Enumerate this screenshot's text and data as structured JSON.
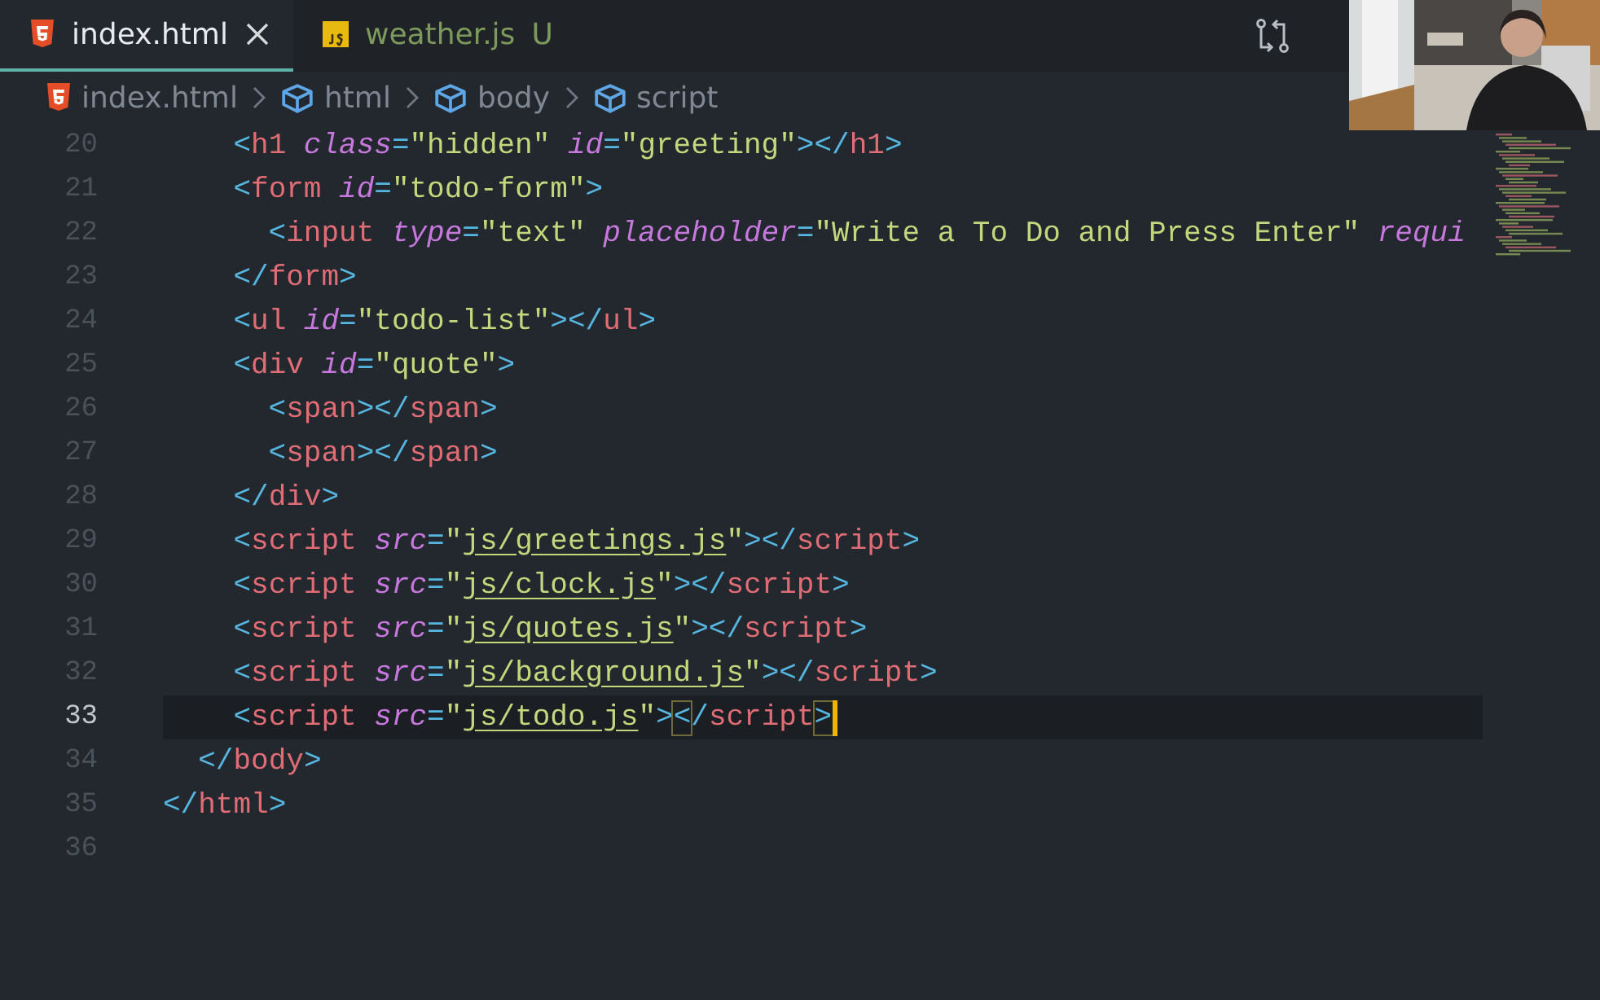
{
  "tabs": [
    {
      "label": "index.html",
      "kind": "html",
      "selected": true,
      "modified": false
    },
    {
      "label": "weather.js",
      "kind": "js",
      "selected": false,
      "modified": true,
      "badge": "U"
    }
  ],
  "breadcrumb": [
    {
      "label": "index.html",
      "kind": "file"
    },
    {
      "label": "html",
      "kind": "element"
    },
    {
      "label": "body",
      "kind": "element"
    },
    {
      "label": "script",
      "kind": "element"
    }
  ],
  "lines": [
    {
      "number": "20",
      "current": false,
      "tokens": [
        {
          "kind": "punct",
          "text": "    <"
        },
        {
          "kind": "tag",
          "text": "h1"
        },
        {
          "kind": "attr",
          "text": " class"
        },
        {
          "kind": "punct",
          "text": "="
        },
        {
          "kind": "string",
          "text": "\"hidden\""
        },
        {
          "kind": "attr",
          "text": " id"
        },
        {
          "kind": "punct",
          "text": "="
        },
        {
          "kind": "string",
          "text": "\"greeting\""
        },
        {
          "kind": "punct",
          "text": "></"
        },
        {
          "kind": "tag",
          "text": "h1"
        },
        {
          "kind": "punct",
          "text": ">"
        }
      ]
    },
    {
      "number": "21",
      "current": false,
      "tokens": [
        {
          "kind": "punct",
          "text": "    <"
        },
        {
          "kind": "tag",
          "text": "form"
        },
        {
          "kind": "attr",
          "text": " id"
        },
        {
          "kind": "punct",
          "text": "="
        },
        {
          "kind": "string",
          "text": "\"todo-form\""
        },
        {
          "kind": "punct",
          "text": ">"
        }
      ]
    },
    {
      "number": "22",
      "current": false,
      "tokens": [
        {
          "kind": "punct",
          "text": "      <"
        },
        {
          "kind": "tag",
          "text": "input"
        },
        {
          "kind": "attr",
          "text": " type"
        },
        {
          "kind": "punct",
          "text": "="
        },
        {
          "kind": "string",
          "text": "\"text\""
        },
        {
          "kind": "attr",
          "text": " placeholder"
        },
        {
          "kind": "punct",
          "text": "="
        },
        {
          "kind": "string",
          "text": "\"Write a To Do and Press Enter\""
        },
        {
          "kind": "attr",
          "text": " requi"
        }
      ]
    },
    {
      "number": "23",
      "current": false,
      "tokens": [
        {
          "kind": "punct",
          "text": "    </"
        },
        {
          "kind": "tag",
          "text": "form"
        },
        {
          "kind": "punct",
          "text": ">"
        }
      ]
    },
    {
      "number": "24",
      "current": false,
      "tokens": [
        {
          "kind": "punct",
          "text": "    <"
        },
        {
          "kind": "tag",
          "text": "ul"
        },
        {
          "kind": "attr",
          "text": " id"
        },
        {
          "kind": "punct",
          "text": "="
        },
        {
          "kind": "string",
          "text": "\"todo-list\""
        },
        {
          "kind": "punct",
          "text": "></"
        },
        {
          "kind": "tag",
          "text": "ul"
        },
        {
          "kind": "punct",
          "text": ">"
        }
      ]
    },
    {
      "number": "25",
      "current": false,
      "tokens": [
        {
          "kind": "punct",
          "text": "    <"
        },
        {
          "kind": "tag",
          "text": "div"
        },
        {
          "kind": "attr",
          "text": " id"
        },
        {
          "kind": "punct",
          "text": "="
        },
        {
          "kind": "string",
          "text": "\"quote\""
        },
        {
          "kind": "punct",
          "text": ">"
        }
      ]
    },
    {
      "number": "26",
      "current": false,
      "tokens": [
        {
          "kind": "punct",
          "text": "      <"
        },
        {
          "kind": "tag",
          "text": "span"
        },
        {
          "kind": "punct",
          "text": "></"
        },
        {
          "kind": "tag",
          "text": "span"
        },
        {
          "kind": "punct",
          "text": ">"
        }
      ]
    },
    {
      "number": "27",
      "current": false,
      "tokens": [
        {
          "kind": "punct",
          "text": "      <"
        },
        {
          "kind": "tag",
          "text": "span"
        },
        {
          "kind": "punct",
          "text": "></"
        },
        {
          "kind": "tag",
          "text": "span"
        },
        {
          "kind": "punct",
          "text": ">"
        }
      ]
    },
    {
      "number": "28",
      "current": false,
      "tokens": [
        {
          "kind": "punct",
          "text": "    </"
        },
        {
          "kind": "tag",
          "text": "div"
        },
        {
          "kind": "punct",
          "text": ">"
        }
      ]
    },
    {
      "number": "29",
      "current": false,
      "tokens": [
        {
          "kind": "punct",
          "text": "    <"
        },
        {
          "kind": "tag",
          "text": "script"
        },
        {
          "kind": "attr",
          "text": " src"
        },
        {
          "kind": "punct",
          "text": "="
        },
        {
          "kind": "string",
          "text": "\""
        },
        {
          "kind": "link",
          "text": "js/greetings.js"
        },
        {
          "kind": "string",
          "text": "\""
        },
        {
          "kind": "punct",
          "text": "></"
        },
        {
          "kind": "tag",
          "text": "script"
        },
        {
          "kind": "punct",
          "text": ">"
        }
      ]
    },
    {
      "number": "30",
      "current": false,
      "tokens": [
        {
          "kind": "punct",
          "text": "    <"
        },
        {
          "kind": "tag",
          "text": "script"
        },
        {
          "kind": "attr",
          "text": " src"
        },
        {
          "kind": "punct",
          "text": "="
        },
        {
          "kind": "string",
          "text": "\""
        },
        {
          "kind": "link",
          "text": "js/clock.js"
        },
        {
          "kind": "string",
          "text": "\""
        },
        {
          "kind": "punct",
          "text": "></"
        },
        {
          "kind": "tag",
          "text": "script"
        },
        {
          "kind": "punct",
          "text": ">"
        }
      ]
    },
    {
      "number": "31",
      "current": false,
      "tokens": [
        {
          "kind": "punct",
          "text": "    <"
        },
        {
          "kind": "tag",
          "text": "script"
        },
        {
          "kind": "attr",
          "text": " src"
        },
        {
          "kind": "punct",
          "text": "="
        },
        {
          "kind": "string",
          "text": "\""
        },
        {
          "kind": "link",
          "text": "js/quotes.js"
        },
        {
          "kind": "string",
          "text": "\""
        },
        {
          "kind": "punct",
          "text": "></"
        },
        {
          "kind": "tag",
          "text": "script"
        },
        {
          "kind": "punct",
          "text": ">"
        }
      ]
    },
    {
      "number": "32",
      "current": false,
      "tokens": [
        {
          "kind": "punct",
          "text": "    <"
        },
        {
          "kind": "tag",
          "text": "script"
        },
        {
          "kind": "attr",
          "text": " src"
        },
        {
          "kind": "punct",
          "text": "="
        },
        {
          "kind": "string",
          "text": "\""
        },
        {
          "kind": "link",
          "text": "js/background.js"
        },
        {
          "kind": "string",
          "text": "\""
        },
        {
          "kind": "punct",
          "text": "></"
        },
        {
          "kind": "tag",
          "text": "script"
        },
        {
          "kind": "punct",
          "text": ">"
        }
      ]
    },
    {
      "number": "33",
      "current": true,
      "tokens": [
        {
          "kind": "punct",
          "text": "    <"
        },
        {
          "kind": "tag",
          "text": "script"
        },
        {
          "kind": "attr",
          "text": " src"
        },
        {
          "kind": "punct",
          "text": "="
        },
        {
          "kind": "string",
          "text": "\""
        },
        {
          "kind": "link",
          "text": "js/todo.js"
        },
        {
          "kind": "string",
          "text": "\""
        },
        {
          "kind": "punct",
          "text": ">"
        },
        {
          "kind": "match",
          "text": "<"
        },
        {
          "kind": "punct",
          "text": "/"
        },
        {
          "kind": "tag",
          "text": "script"
        },
        {
          "kind": "match",
          "text": ">"
        }
      ]
    },
    {
      "number": "34",
      "current": false,
      "tokens": [
        {
          "kind": "punct",
          "text": "  </"
        },
        {
          "kind": "tag",
          "text": "body"
        },
        {
          "kind": "punct",
          "text": ">"
        }
      ]
    },
    {
      "number": "35",
      "current": false,
      "tokens": [
        {
          "kind": "punct",
          "text": "</"
        },
        {
          "kind": "tag",
          "text": "html"
        },
        {
          "kind": "punct",
          "text": ">"
        }
      ]
    },
    {
      "number": "36",
      "current": false
    }
  ]
}
